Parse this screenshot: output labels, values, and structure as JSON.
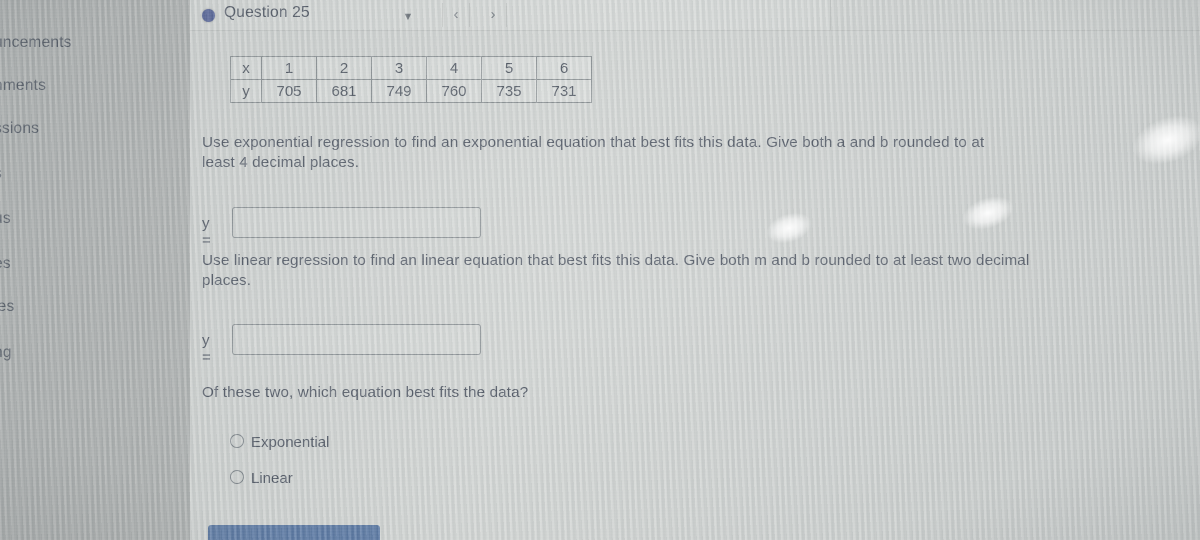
{
  "sidebar": {
    "items": [
      {
        "label": "uncements",
        "full": "Announcements"
      },
      {
        "label": "nments",
        "full": "Assignments"
      },
      {
        "label": "ssions",
        "full": "Discussions"
      },
      {
        "label": "s",
        "full": "Grades"
      },
      {
        "label": "us",
        "full": "Syllabus"
      },
      {
        "label": "es",
        "full": "Modules"
      },
      {
        "label": "les",
        "full": "Files"
      },
      {
        "label": "ng",
        "full": "Settings"
      }
    ]
  },
  "header": {
    "title": "Question 25",
    "bullet_color": "#41508c",
    "caret_icon": "▼",
    "prev_icon": "‹",
    "next_icon": "›"
  },
  "table": {
    "row_x_label": "x",
    "row_y_label": "y",
    "x": [
      "1",
      "2",
      "3",
      "4",
      "5",
      "6"
    ],
    "y": [
      "705",
      "681",
      "749",
      "760",
      "735",
      "731"
    ]
  },
  "prompts": {
    "exponential": "Use exponential regression to find an exponential equation that best fits this data. Give both a and b rounded to at least 4 decimal places.",
    "linear": "Use linear regression to find an linear equation that best fits this data. Give both m and b rounded to at least two decimal places.",
    "choose": "Of these two, which equation best fits the data?"
  },
  "answers": {
    "label": "y =",
    "exponential_value": "",
    "linear_value": "",
    "placeholder": ""
  },
  "choices": [
    {
      "label": "Exponential",
      "selected": false
    },
    {
      "label": "Linear",
      "selected": false
    }
  ],
  "submit": {
    "label": "",
    "color": "#4a6a9a"
  }
}
